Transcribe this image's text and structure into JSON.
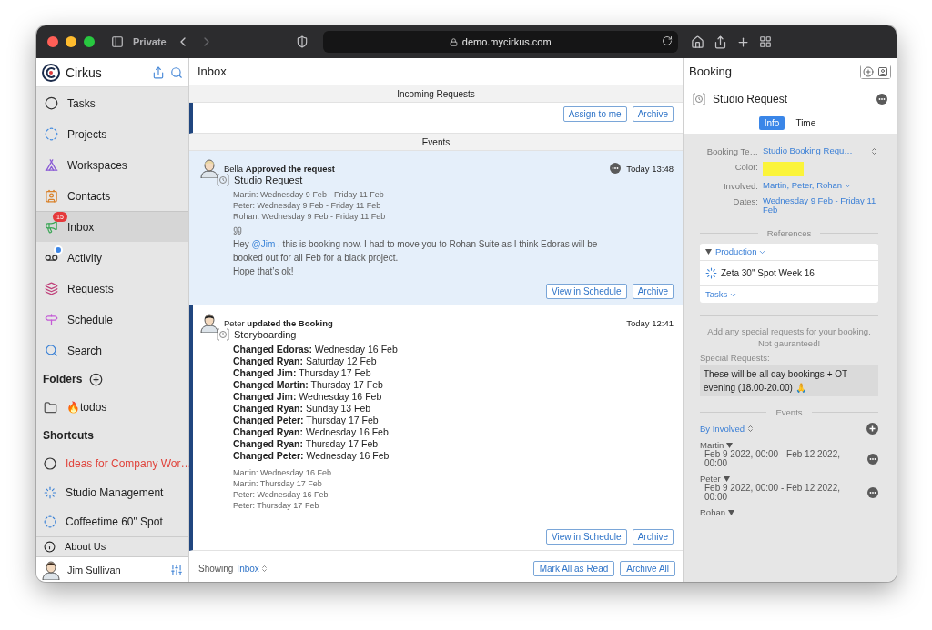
{
  "browser": {
    "private_label": "Private",
    "url": "demo.mycirkus.com"
  },
  "sidebar": {
    "app_name": "Cirkus",
    "items": [
      {
        "label": "Tasks",
        "selected": false,
        "dot": false
      },
      {
        "label": "Projects",
        "selected": false,
        "dot": false
      },
      {
        "label": "Workspaces",
        "selected": false,
        "dot": false
      },
      {
        "label": "Contacts",
        "selected": false,
        "dot": false
      },
      {
        "label": "Inbox",
        "selected": true,
        "dot": false,
        "badge": "15"
      },
      {
        "label": "Activity",
        "selected": false,
        "dot": true
      },
      {
        "label": "Requests",
        "selected": false,
        "dot": false
      },
      {
        "label": "Schedule",
        "selected": false,
        "dot": false
      },
      {
        "label": "Search",
        "selected": false,
        "dot": false
      }
    ],
    "folders_title": "Folders",
    "folders": [
      {
        "label": "🔥todos"
      }
    ],
    "shortcuts_title": "Shortcuts",
    "shortcuts": [
      {
        "label": "Ideas for Company Wor…",
        "color": "#e0443c"
      },
      {
        "label": "Studio Management",
        "color": "#222222"
      },
      {
        "label": "Coffeetime 60\" Spot",
        "color": "#222222"
      }
    ],
    "about": "About Us",
    "user": "Jim Sullivan"
  },
  "inbox": {
    "title": "Inbox",
    "incoming": {
      "title": "Incoming Requests",
      "unread": true,
      "buttons": [
        "Assign to me",
        "Archive"
      ]
    },
    "events_title": "Events",
    "events": [
      {
        "selected": true,
        "unread": false,
        "menu": true,
        "author": "Bella",
        "action": "Approved the request",
        "time": "Today 13:48",
        "item": "Studio Request",
        "details": [
          "Martin: Wednesday 9 Feb - Friday 11 Feb",
          "Peter: Wednesday 9 Feb - Friday 11 Feb",
          "Rohan: Wednesday 9 Feb - Friday 11 Feb"
        ],
        "message": {
          "before": "Hey",
          "mention": "@Jim",
          "after": ", this is booking now. I had to move you to Rohan Suite as I think Edoras will be booked out for all Feb for a black project.",
          "closing": "Hope that’s ok!"
        },
        "buttons": [
          "View in Schedule",
          "Archive"
        ]
      },
      {
        "selected": false,
        "unread": true,
        "menu": false,
        "author": "Peter",
        "action": "updated the Booking",
        "time": "Today 12:41",
        "item": "Storyboarding",
        "changes": [
          "**Changed Edoras:** Wednesday 16 Feb",
          "**Changed Ryan:** Saturday 12 Feb",
          "**Changed Jim:** Thursday 17 Feb",
          "**Changed Martin:** Thursday 17 Feb",
          "**Changed Jim:** Wednesday 16 Feb",
          "**Changed Ryan:** Sunday 13 Feb",
          "**Changed Peter:** Thursday 17 Feb",
          "**Changed Ryan:** Wednesday 16 Feb",
          "**Changed Ryan:** Thursday 17 Feb",
          "**Changed Peter:** Wednesday 16 Feb"
        ],
        "details": [
          "Martin: Wednesday 16 Feb",
          "Martin: Thursday 17 Feb",
          "Peter: Wednesday 16 Feb",
          "Peter: Thursday 17 Feb"
        ],
        "buttons": [
          "View in Schedule",
          "Archive"
        ]
      }
    ],
    "footer": {
      "showing_label": "Showing",
      "filter": "Inbox",
      "buttons": [
        "Mark All as Read",
        "Archive All"
      ]
    }
  },
  "booking": {
    "title": "Booking",
    "item": "Studio Request",
    "tabs": [
      {
        "label": "Info",
        "selected": true
      },
      {
        "label": "Time",
        "selected": false
      }
    ],
    "fields": [
      {
        "kind": "select",
        "label": "Booking Te…",
        "value": "Studio Booking Requ…"
      },
      {
        "kind": "color",
        "label": "Color:",
        "color": "#fbf43a"
      },
      {
        "kind": "dropdown",
        "label": "Involved:",
        "value": "Martin, Peter, Rohan"
      },
      {
        "kind": "link",
        "label": "Dates:",
        "value": "Wednesday 9 Feb - Friday 11 Feb"
      }
    ],
    "references_title": "References",
    "references": {
      "group": "Production",
      "items": [
        "Zeta 30\" Spot Week 16"
      ],
      "tasks": "Tasks"
    },
    "note": "Add any special requests for your booking. Not gauranteed!",
    "special_label": "Special Requests:",
    "special_value": "These will be all day bookings + OT evening (18.00-20.00) 🙏",
    "events_title": "Events",
    "sort": "By Involved",
    "groups": [
      {
        "name": "Martin",
        "ranges": [
          "Feb 9 2022, 00:00 - Feb 12 2022, 00:00"
        ]
      },
      {
        "name": "Peter",
        "ranges": [
          "Feb 9 2022, 00:00 - Feb 12 2022, 00:00"
        ]
      },
      {
        "name": "Rohan"
      }
    ]
  }
}
